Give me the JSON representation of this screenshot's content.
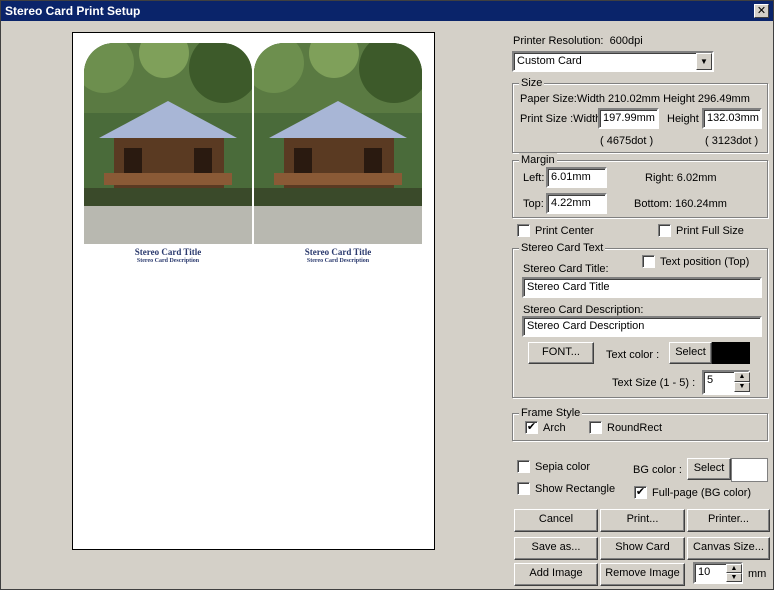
{
  "window": {
    "title": "Stereo Card Print Setup"
  },
  "preview": {
    "left_title": "Stereo Card Title",
    "left_desc": "Stereo Card Description",
    "right_title": "Stereo Card Title",
    "right_desc": "Stereo Card Description"
  },
  "printer_resolution": {
    "label": "Printer Resolution:",
    "value": "600dpi"
  },
  "card_type": {
    "selected": "Custom Card"
  },
  "size": {
    "group_label": "Size",
    "paper_size": "Paper Size:Width 210.02mm Height 296.49mm",
    "print_size_label": "Print Size :Width",
    "width_value": "197.99mm",
    "height_label": "Height",
    "height_value": "132.03mm",
    "width_dots": "( 4675dot )",
    "height_dots": "( 3123dot )"
  },
  "margin": {
    "group_label": "Margin",
    "left_label": "Left:",
    "left_value": "6.01mm",
    "right_text": "Right:  6.02mm",
    "top_label": "Top:",
    "top_value": "4.22mm",
    "bottom_text": "Bottom:  160.24mm"
  },
  "print_center": {
    "label": "Print Center",
    "checked": false
  },
  "print_full_size": {
    "label": "Print Full Size",
    "checked": false
  },
  "stereo_text": {
    "group_label": "Stereo Card Text",
    "title_label": "Stereo Card Title:",
    "text_position_label": "Text position (Top)",
    "title_value": "Stereo Card Title",
    "desc_label": "Stereo Card Description:",
    "desc_value": "Stereo Card Description",
    "font_button": "FONT...",
    "text_color_label": "Text color :",
    "select_button": "Select",
    "text_color": "#000000",
    "text_size_label": "Text Size (1 - 5) :",
    "text_size_value": "5"
  },
  "frame_style": {
    "group_label": "Frame Style",
    "arch_label": "Arch",
    "arch_checked": true,
    "roundrect_label": "RoundRect",
    "roundrect_checked": false
  },
  "options": {
    "sepia_label": "Sepia color",
    "show_rect_label": "Show Rectangle",
    "bg_color_label": "BG color :",
    "bg_select_button": "Select",
    "bg_color": "#ffffff",
    "full_page_label": "Full-page (BG color)"
  },
  "buttons": {
    "cancel": "Cancel",
    "print": "Print...",
    "printer": "Printer...",
    "save_as": "Save as...",
    "show_card": "Show Card",
    "canvas_size": "Canvas Size...",
    "add_image": "Add Image",
    "remove_image": "Remove Image"
  },
  "gap": {
    "value": "10",
    "unit": "mm"
  },
  "check_mark": "✔",
  "arrow_down": "▼",
  "arrow_up": "▲",
  "close_glyph": "✕"
}
